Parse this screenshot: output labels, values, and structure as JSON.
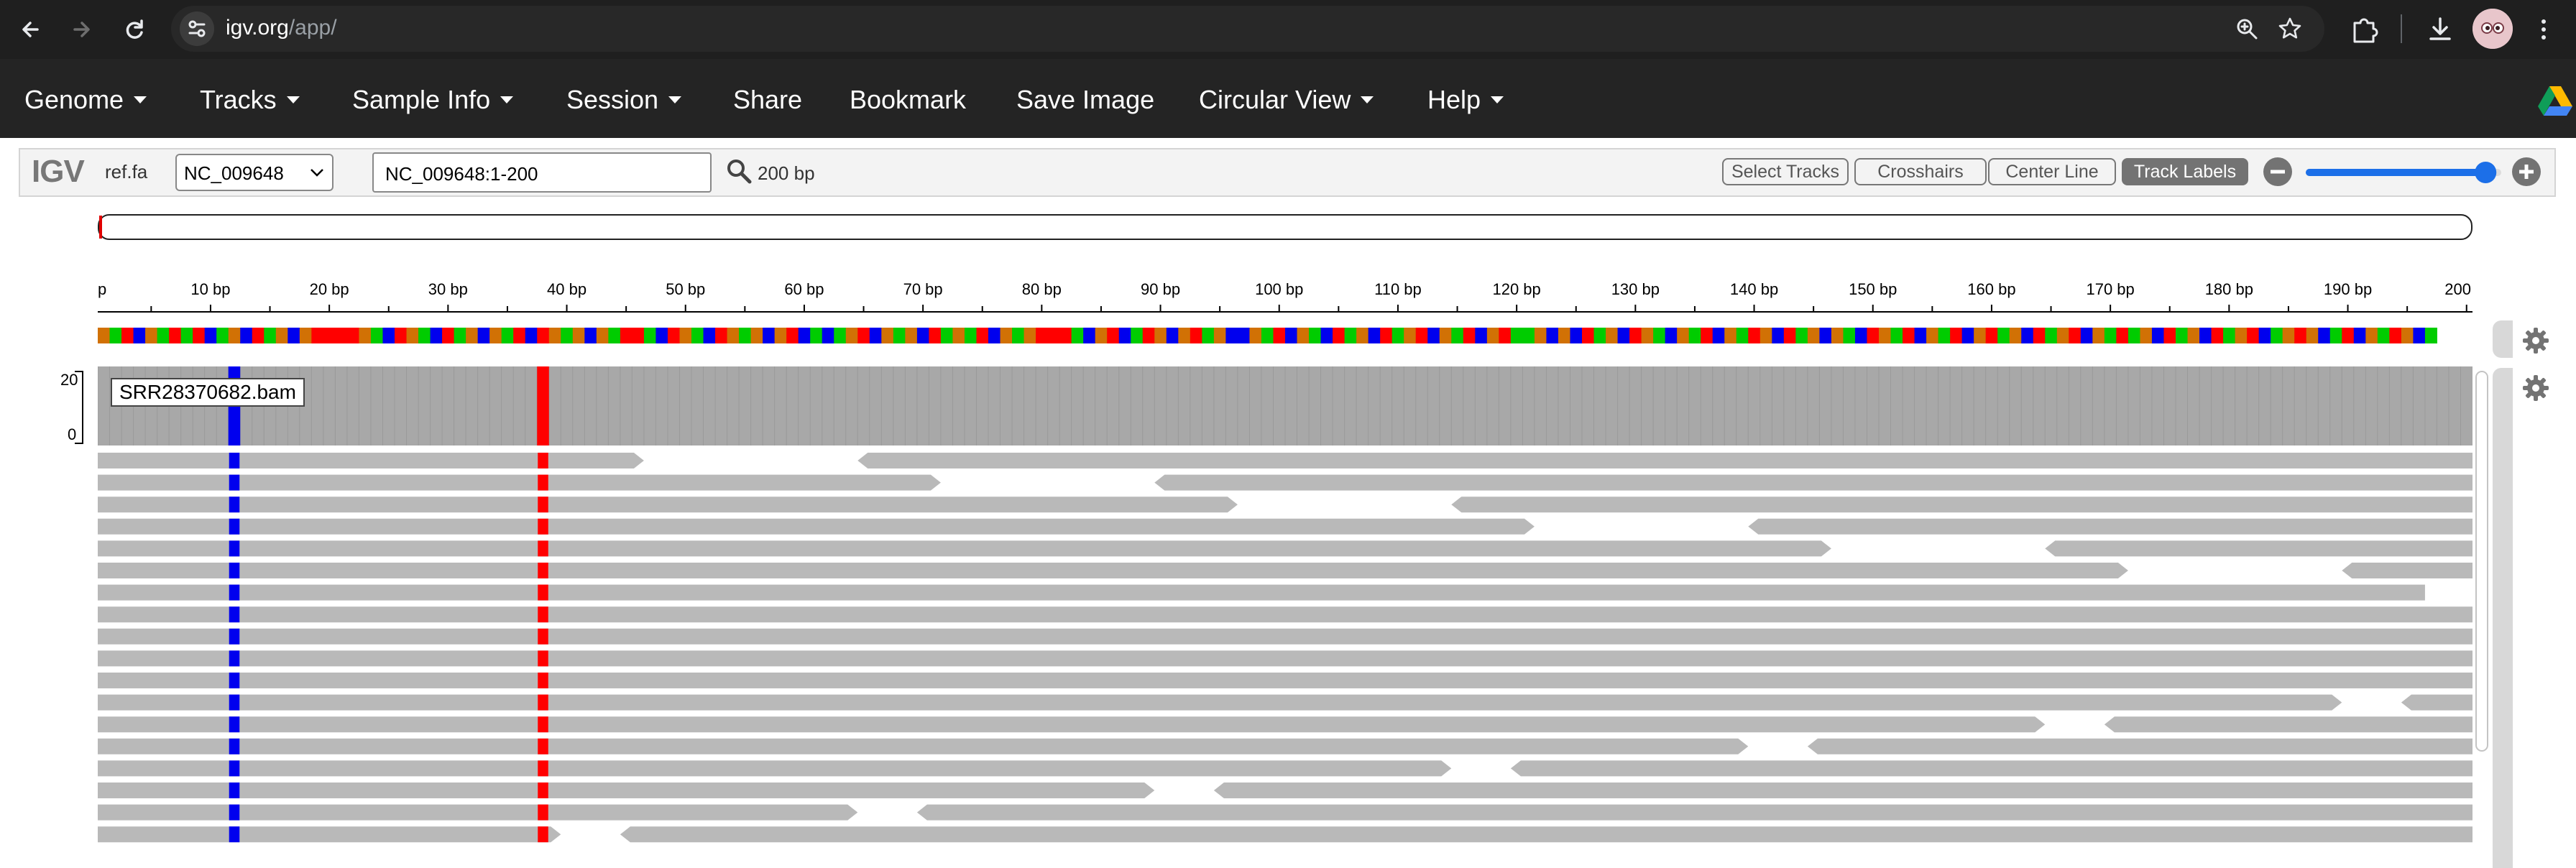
{
  "browser": {
    "url_host": "igv.org",
    "url_path": "/app/"
  },
  "navbar": {
    "items": [
      {
        "label": "Genome",
        "dropdown": true
      },
      {
        "label": "Tracks",
        "dropdown": true
      },
      {
        "label": "Sample Info",
        "dropdown": true
      },
      {
        "label": "Session",
        "dropdown": true
      },
      {
        "label": "Share",
        "dropdown": false
      },
      {
        "label": "Bookmark",
        "dropdown": false
      },
      {
        "label": "Save Image",
        "dropdown": false
      },
      {
        "label": "Circular View",
        "dropdown": true
      },
      {
        "label": "Help",
        "dropdown": true
      }
    ]
  },
  "igv": {
    "logo": "IGV",
    "genome": "ref.fa",
    "chromosome": "NC_009648",
    "locus": "NC_009648:1-200",
    "window_size": "200 bp",
    "buttons": {
      "select_tracks": "Select Tracks",
      "crosshairs": "Crosshairs",
      "center_line": "Center Line",
      "track_labels": "Track Labels"
    },
    "zoom_level": 0.92,
    "ruler": {
      "start_label": "p",
      "tick_labels": [
        "10 bp",
        "20 bp",
        "30 bp",
        "40 bp",
        "50 bp",
        "60 bp",
        "70 bp",
        "80 bp",
        "90 bp",
        "100 bp",
        "110 bp",
        "120 bp",
        "130 bp",
        "140 bp",
        "150 bp",
        "160 bp",
        "170 bp",
        "180 bp",
        "190 bp",
        "200"
      ],
      "start_bp": 0.5,
      "end_bp": 200.5
    },
    "sequence": "GATCGATATCAGCTAGCGTTTTGACTGACTAGCGATCTGAGCGATTACTGACTGAGCGTCACAGTCGAGCTAGATCGAGTTTACGTCATGCGTAGCCGATCGACTAGCTAGTCGATCGTAAGCGCTAGCTGACGATCGATGCTAGCGACTGATCGATCGTAGCTAGTCGATAGCTAGCTAGTCAGTGCATCGATGCA",
    "base_colors": {
      "A": "#00cc00",
      "C": "#0000ee",
      "G": "#d17105",
      "T": "#ff0000"
    },
    "track": {
      "name": "SRR28370682.bam",
      "coverage_max": "20",
      "coverage_min": "0",
      "mismatch_positions": [
        {
          "bp": 12,
          "color": "#0000ee"
        },
        {
          "bp": 38,
          "color": "#ff0000"
        }
      ],
      "read_color": "#b9b9b9",
      "coverage_color": "#a8a8a8",
      "alignment_rows": [
        [
          [
            1,
            46
          ],
          [
            65,
            200
          ]
        ],
        [
          [
            1,
            71
          ],
          [
            90,
            200
          ]
        ],
        [
          [
            1,
            96
          ],
          [
            115,
            200
          ]
        ],
        [
          [
            1,
            121
          ],
          [
            140,
            200
          ]
        ],
        [
          [
            1,
            146
          ],
          [
            165,
            200
          ]
        ],
        [
          [
            1,
            171
          ],
          [
            190,
            200
          ]
        ],
        [
          [
            1,
            196
          ]
        ],
        [
          [
            1,
            200
          ]
        ],
        [
          [
            1,
            200
          ]
        ],
        [
          [
            1,
            200
          ]
        ],
        [
          [
            1,
            200
          ]
        ],
        [
          [
            1,
            189
          ],
          [
            195,
            200
          ]
        ],
        [
          [
            1,
            164
          ],
          [
            170,
            200
          ]
        ],
        [
          [
            1,
            139
          ],
          [
            145,
            200
          ]
        ],
        [
          [
            1,
            114
          ],
          [
            120,
            200
          ]
        ],
        [
          [
            1,
            89
          ],
          [
            95,
            200
          ]
        ],
        [
          [
            1,
            64
          ],
          [
            70,
            200
          ]
        ],
        [
          [
            1,
            39
          ],
          [
            45,
            200
          ]
        ]
      ]
    }
  }
}
